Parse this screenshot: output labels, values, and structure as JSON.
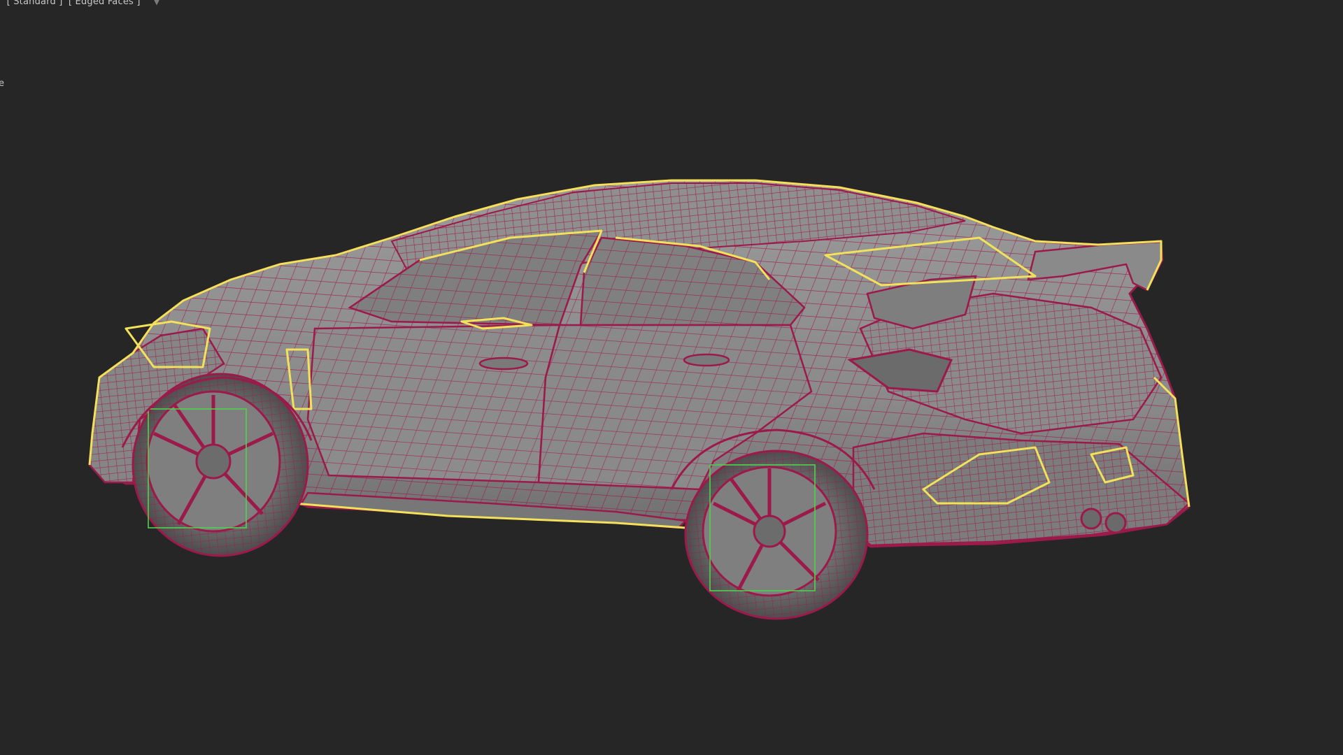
{
  "viewport": {
    "label_parts": [
      "]",
      "[ Standard ]",
      "[ Edged Faces ]"
    ],
    "filter_glyph": "▼",
    "side_fragment": "e",
    "background": "#262626"
  },
  "colors": {
    "mesh_fill": "#8e8e8e",
    "mesh_fill_dark": "#6f6f6f",
    "wire": "#9c1a4a",
    "selection_outline": "#f2e15a",
    "wheel_bbox": "#4fd24f",
    "tire": "#555555"
  },
  "model": {
    "icon": "car-wireframe-icon"
  }
}
